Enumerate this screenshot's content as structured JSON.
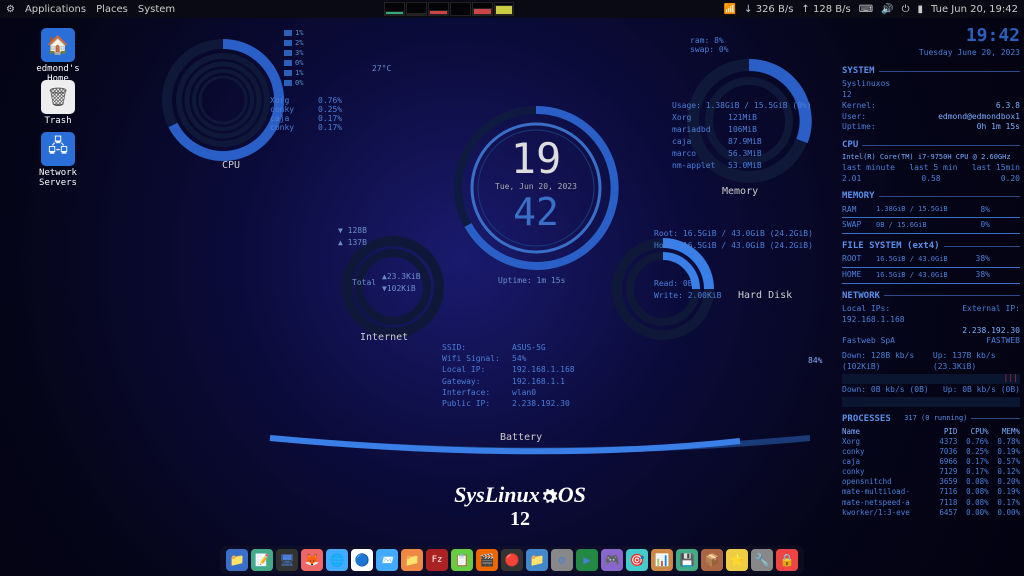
{
  "topbar": {
    "menus": [
      "Applications",
      "Places",
      "System"
    ],
    "net_down": "326 B/s",
    "net_up": "128 B/s",
    "clock": "Tue Jun 20, 19:42"
  },
  "desktop": {
    "home": "edmond's Home",
    "trash": "Trash",
    "network": "Network Servers"
  },
  "clock": {
    "hour": "19",
    "minute": "42",
    "date": "Tue, Jun 20, 2023",
    "uptime": "Uptime: 1m 15s"
  },
  "cpu": {
    "label": "CPU",
    "temp": "27°C",
    "pct_list": [
      "1%",
      "2%",
      "3%",
      "0%",
      "1%",
      "0%"
    ],
    "procs": [
      {
        "name": "Xorg",
        "pct": "0.76%"
      },
      {
        "name": "conky",
        "pct": "0.25%"
      },
      {
        "name": "caja",
        "pct": "0.17%"
      },
      {
        "name": "conky",
        "pct": "0.17%"
      }
    ]
  },
  "memory": {
    "label": "Memory",
    "ram": "ram: 8%",
    "swap": "swap: 0%",
    "usage": "Usage: 1.38GiB / 15.5GiB (8%)",
    "procs": [
      {
        "name": "Xorg",
        "val": "121MiB"
      },
      {
        "name": "mariadbd",
        "val": "106MiB"
      },
      {
        "name": "caja",
        "val": "87.9MiB"
      },
      {
        "name": "marco",
        "val": "56.3MiB"
      },
      {
        "name": "nm-applet",
        "val": "53.0MiB"
      }
    ]
  },
  "disk": {
    "label": "Hard Disk",
    "root": "Root: 16.5GiB / 43.0GiB (24.2GiB)",
    "home": "Home: 16.5GiB / 43.0GiB (24.2GiB)",
    "read": "Read:  0B",
    "write": "Write: 2.00KiB"
  },
  "internet": {
    "label": "Internet",
    "down": "▼ 128B",
    "up": "▲ 137B",
    "total_label": "Total",
    "total_up": "▲23.3KiB",
    "total_down": "▼102KiB"
  },
  "netdetail": {
    "ssid_l": "SSID:",
    "ssid": "ASUS-5G",
    "signal_l": "Wifi Signal:",
    "signal": "54%",
    "localip_l": "Local IP:",
    "localip": "192.168.1.168",
    "gateway_l": "Gateway:",
    "gateway": "192.168.1.1",
    "iface_l": "Interface:",
    "iface": "wlan0",
    "pubip_l": "Public IP:",
    "pubip": "2.238.192.30"
  },
  "battery": {
    "label": "Battery",
    "pct": "84%"
  },
  "os": {
    "name": "SysLinux   OS",
    "ver": "12"
  },
  "sidebar": {
    "time": "19:42",
    "date": "Tuesday June 20, 2023",
    "system_h": "SYSTEM",
    "sys": {
      "name": "Syslinuxos",
      "ver": "12",
      "kernel_l": "Kernel:",
      "kernel": "6.3.8",
      "user_l": "User:",
      "user": "edmond@edmondbox1",
      "uptime_l": "Uptime:",
      "uptime": "0h 1m 15s"
    },
    "cpu_h": "CPU",
    "cpu": {
      "model": "Intel(R) Core(TM) i7-9750H CPU @ 2.60GHz",
      "lm_l": "last minute",
      "l5_l": "last 5 min",
      "l15_l": "last 15min",
      "lm": "2.01",
      "l5": "0.58",
      "l15": "0.20"
    },
    "mem_h": "MEMORY",
    "mem": {
      "ram_l": "RAM",
      "ram": "1.38GiB / 15.5GiB",
      "ram_pct": "8%",
      "swap_l": "SWAP",
      "swap": "0B / 15.6GiB",
      "swap_pct": "0%"
    },
    "fs_h": "FILE SYSTEM (ext4)",
    "fs": {
      "root_l": "ROOT",
      "root": "16.5GiB / 43.0GiB",
      "root_pct": "38%",
      "home_l": "HOME",
      "home": "16.5GiB / 43.0GiB",
      "home_pct": "38%"
    },
    "net_h": "NETWORK",
    "net": {
      "localip_l": "Local IPs:",
      "extip_l": "External IP:",
      "localip": "192.168.1.168",
      "extip": "2.238.192.30",
      "isp": "Fastweb SpA",
      "isp2": "FASTWEB",
      "down": "Down: 128B kb/s (102KiB)",
      "up": "Up: 137B kb/s (23.3KiB)",
      "down2": "Down: 0B kb/s (0B)",
      "up2": "Up: 0B kb/s (0B)"
    },
    "proc_h": "PROCESSES",
    "proc_sub": "317 (0 running)",
    "proc_cols": {
      "name": "Name",
      "pid": "PID",
      "cpu": "CPU%",
      "mem": "MEM%"
    },
    "procs": [
      {
        "n": "Xorg",
        "p": "4373",
        "c": "0.76%",
        "m": "0.78%"
      },
      {
        "n": "conky",
        "p": "7036",
        "c": "0.25%",
        "m": "0.19%"
      },
      {
        "n": "caja",
        "p": "6966",
        "c": "0.17%",
        "m": "0.57%"
      },
      {
        "n": "conky",
        "p": "7129",
        "c": "0.17%",
        "m": "0.12%"
      },
      {
        "n": "opensnitchd",
        "p": "3659",
        "c": "0.08%",
        "m": "0.20%"
      },
      {
        "n": "mate-multiload-",
        "p": "7116",
        "c": "0.08%",
        "m": "0.19%"
      },
      {
        "n": "mate-netspeed-a",
        "p": "7118",
        "c": "0.08%",
        "m": "0.17%"
      },
      {
        "n": "kworker/1:3-eve",
        "p": "6457",
        "c": "0.00%",
        "m": "0.00%"
      }
    ]
  },
  "dock": [
    "📁",
    "📝",
    "🖥",
    "🦊",
    "🌐",
    "🔵",
    "📨",
    "📁",
    "Fz",
    "📋",
    "🎬",
    "🔴",
    "📁",
    "⚙",
    "▶",
    "🎮",
    "🎯",
    "📊",
    "💾",
    "📦",
    "⭐",
    "🔧",
    "🔒"
  ]
}
